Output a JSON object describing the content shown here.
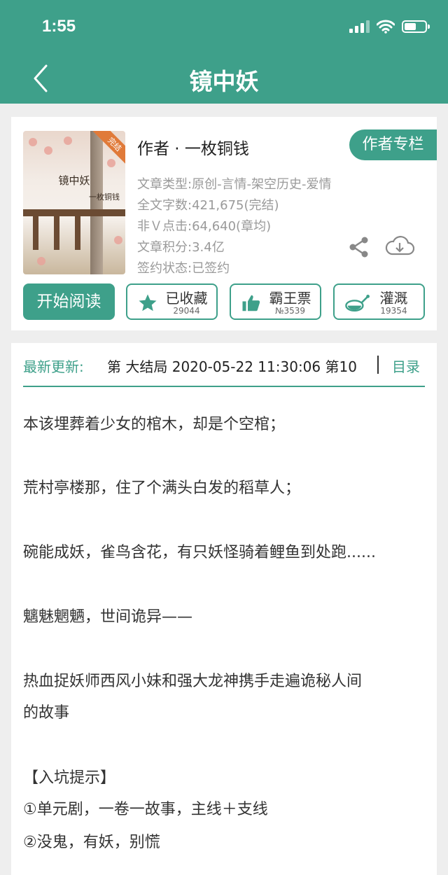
{
  "status_bar": {
    "time": "1:55"
  },
  "nav": {
    "title": "镜中妖",
    "back_icon": "chevron-left-icon"
  },
  "book": {
    "cover_title": "镜中妖",
    "cover_author": "一枚铜钱",
    "cover_badge": "完结",
    "author_line": "作者 · 一枚铜钱",
    "author_column": "作者专栏",
    "meta": [
      "文章类型:原创-言情-架空历史-爱情",
      "全文字数:421,675(完结)",
      "非Ｖ点击:64,640(章均)",
      "文章积分:3.4亿",
      "签约状态:已签约"
    ]
  },
  "actions": {
    "read": "开始阅读",
    "collect": {
      "label": "已收藏",
      "count": "29044"
    },
    "ticket": {
      "label": "霸王票",
      "count": "№3539"
    },
    "water": {
      "label": "灌溉",
      "count": "19354"
    }
  },
  "update": {
    "label": "最新更新:",
    "text": "第 大结局 2020-05-22 11:30:06 第10",
    "toc": "目录"
  },
  "description": [
    "本该埋葬着少女的棺木，却是个空棺；",
    "荒村亭楼那，住了个满头白发的稻草人；",
    "碗能成妖，雀鸟含花，有只妖怪骑着鲤鱼到处跑......",
    "魑魅魍魉，世间诡异——",
    "热血捉妖师西风小妹和强大龙神携手走遍诡秘人间",
    "的故事",
    "【入坑提示】",
    "①单元剧，一卷一故事，主线＋支线",
    "②没鬼，有妖，别慌"
  ],
  "colors": {
    "accent": "#3ea08a",
    "meta_text": "#9a9a9a"
  }
}
